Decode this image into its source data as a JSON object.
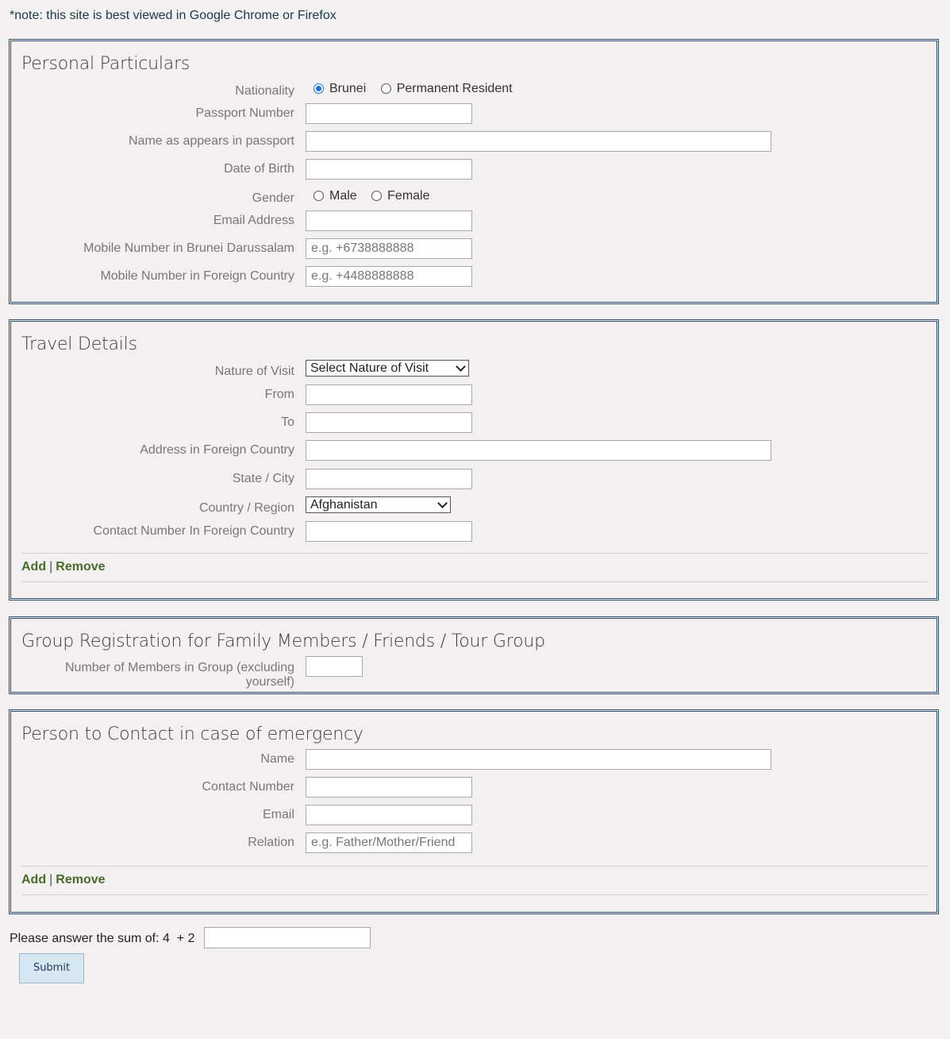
{
  "note": "*note: this site is best viewed in Google Chrome or Firefox",
  "personal": {
    "title": "Personal Particulars",
    "nationality_label": "Nationality",
    "nationality_options": [
      "Brunei",
      "Permanent Resident"
    ],
    "nationality_selected": "Brunei",
    "passport_label": "Passport Number",
    "name_label": "Name as appears in passport",
    "dob_label": "Date of Birth",
    "gender_label": "Gender",
    "gender_options": [
      "Male",
      "Female"
    ],
    "email_label": "Email Address",
    "mobile_brunei_label": "Mobile Number in Brunei Darussalam",
    "mobile_brunei_placeholder": "e.g. +6738888888",
    "mobile_foreign_label": "Mobile Number in Foreign Country",
    "mobile_foreign_placeholder": "e.g. +4488888888"
  },
  "travel": {
    "title": "Travel Details",
    "nature_label": "Nature of Visit",
    "nature_value": "Select Nature of Visit",
    "from_label": "From",
    "to_label": "To",
    "address_label": "Address in Foreign Country",
    "state_label": "State / City",
    "country_label": "Country / Region",
    "country_value": "Afghanistan",
    "contact_label": "Contact Number In Foreign Country",
    "add": "Add",
    "remove": "Remove"
  },
  "group": {
    "title": "Group Registration for Family Members / Friends / Tour Group",
    "members_label": "Number of Members in Group (excluding yourself)"
  },
  "emergency": {
    "title": "Person to Contact in case of emergency",
    "name_label": "Name",
    "contact_label": "Contact Number",
    "email_label": "Email",
    "relation_label": "Relation",
    "relation_placeholder": "e.g. Father/Mother/Friend",
    "add": "Add",
    "remove": "Remove"
  },
  "captcha": {
    "label": "Please answer the sum of: 4  + 2"
  },
  "submit_label": "Submit"
}
